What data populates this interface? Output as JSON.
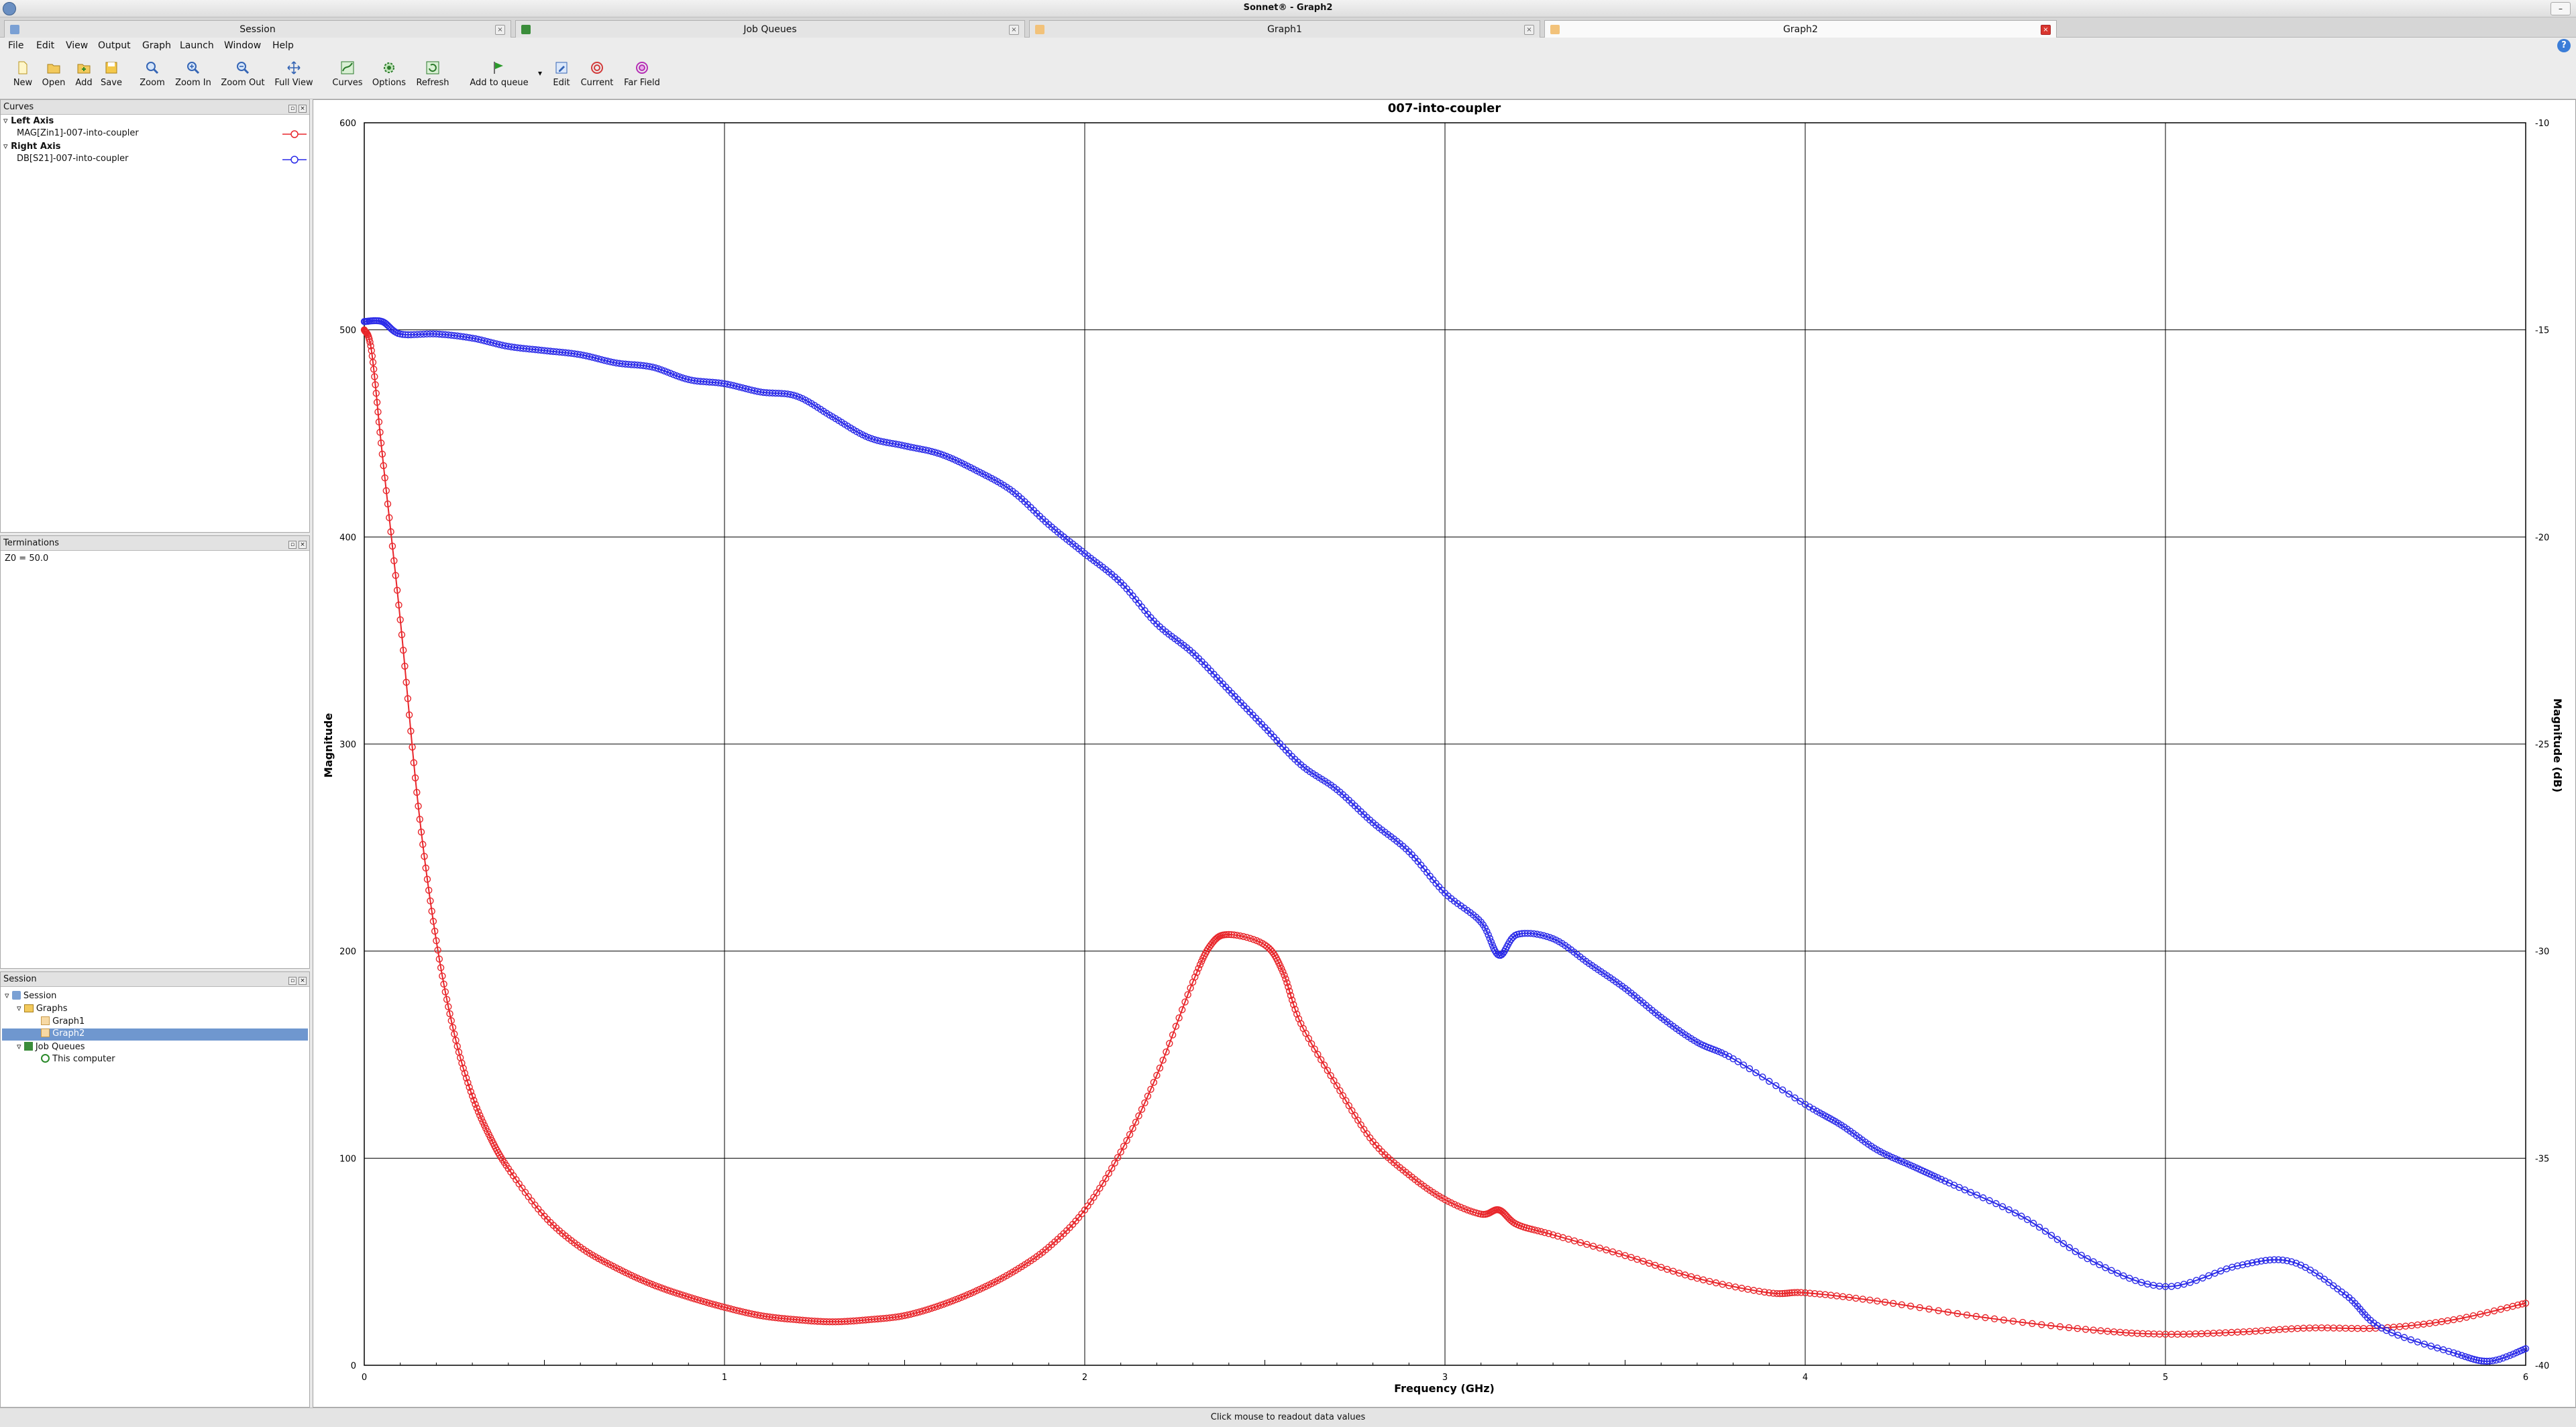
{
  "window": {
    "title": "Sonnet® - Graph2",
    "app_icon": "sonnet-app-icon"
  },
  "tabs": [
    {
      "label": "Session",
      "active": false
    },
    {
      "label": "Job Queues",
      "active": false
    },
    {
      "label": "Graph1",
      "active": false
    },
    {
      "label": "Graph2",
      "active": true
    }
  ],
  "menu": [
    "File",
    "Edit",
    "View",
    "Output",
    "Graph",
    "Launch",
    "Window",
    "Help"
  ],
  "toolbar": [
    {
      "label": "New",
      "icon": "new-file-icon"
    },
    {
      "label": "Open",
      "icon": "open-folder-icon"
    },
    {
      "label": "Add",
      "icon": "add-folder-icon"
    },
    {
      "label": "Save",
      "icon": "save-icon"
    },
    {
      "label": "Zoom",
      "icon": "zoom-icon"
    },
    {
      "label": "Zoom In",
      "icon": "zoom-in-icon"
    },
    {
      "label": "Zoom Out",
      "icon": "zoom-out-icon"
    },
    {
      "label": "Full View",
      "icon": "full-view-icon"
    },
    {
      "label": "Curves",
      "icon": "curves-icon"
    },
    {
      "label": "Options",
      "icon": "options-gear-icon"
    },
    {
      "label": "Refresh",
      "icon": "refresh-icon"
    },
    {
      "label": "Add to queue",
      "icon": "add-to-queue-icon"
    },
    {
      "label": "Edit",
      "icon": "edit-icon"
    },
    {
      "label": "Current",
      "icon": "current-icon"
    },
    {
      "label": "Far Field",
      "icon": "far-field-icon"
    }
  ],
  "curves_panel": {
    "title": "Curves",
    "left_axis_label": "Left Axis",
    "left_curve": "MAG[Zin1]-007-into-coupler",
    "right_axis_label": "Right Axis",
    "right_curve": "DB[S21]-007-into-coupler",
    "left_color": "#e8262b",
    "right_color": "#2a2ae8"
  },
  "terminations_panel": {
    "title": "Terminations",
    "value": "Z0 = 50.0"
  },
  "session_panel": {
    "title": "Session",
    "root": "Session",
    "graphs": "Graphs",
    "graph1": "Graph1",
    "graph2": "Graph2",
    "job_queues": "Job Queues",
    "this_computer": "This computer"
  },
  "status": "Click mouse to readout data values",
  "chart_data": {
    "type": "line",
    "title": "007-into-coupler",
    "xlabel": "Frequency (GHz)",
    "ylabel": "Magnitude",
    "y2label": "Magnitude (dB)",
    "xlim": [
      0,
      6
    ],
    "ylim": [
      0,
      600
    ],
    "y2lim": [
      -40,
      -10
    ],
    "xticks": [
      "0",
      "1",
      "2",
      "3",
      "4",
      "5",
      "6"
    ],
    "yticks": [
      "0",
      "100",
      "200",
      "300",
      "400",
      "500",
      "600"
    ],
    "y2ticks": [
      "-40",
      "-35",
      "-30",
      "-25",
      "-20",
      "-15",
      "-10"
    ],
    "grid": true,
    "series": [
      {
        "name": "MAG[Zin1]-007-into-coupler",
        "axis": "left",
        "color": "#e8262b",
        "x": [
          0,
          0.02,
          0.05,
          0.1,
          0.15,
          0.2,
          0.25,
          0.3,
          0.35,
          0.4,
          0.5,
          0.6,
          0.7,
          0.8,
          0.9,
          1.0,
          1.1,
          1.2,
          1.3,
          1.4,
          1.5,
          1.6,
          1.7,
          1.8,
          1.9,
          2.0,
          2.1,
          2.2,
          2.3,
          2.35,
          2.4,
          2.5,
          2.55,
          2.6,
          2.7,
          2.8,
          2.9,
          3.0,
          3.1,
          3.15,
          3.2,
          3.3,
          3.5,
          3.7,
          3.9,
          4.0,
          4.2,
          4.5,
          4.8,
          5.0,
          5.2,
          5.4,
          5.6,
          5.8,
          6.0
        ],
        "y": [
          500,
          490,
          440,
          360,
          270,
          205,
          160,
          130,
          110,
          95,
          72,
          57,
          47,
          39,
          33,
          28,
          24,
          22,
          21,
          22,
          24,
          29,
          36,
          45,
          57,
          75,
          103,
          140,
          185,
          203,
          208,
          203,
          190,
          165,
          135,
          108,
          92,
          80,
          73,
          75,
          68,
          63,
          53,
          42,
          35,
          35,
          31,
          23,
          17,
          15,
          16,
          18,
          18,
          22,
          30
        ]
      },
      {
        "name": "DB[S21]-007-into-coupler",
        "axis": "right",
        "color": "#2a2ae8",
        "x": [
          0,
          0.05,
          0.1,
          0.2,
          0.3,
          0.4,
          0.5,
          0.6,
          0.7,
          0.8,
          0.9,
          1.0,
          1.1,
          1.2,
          1.3,
          1.4,
          1.5,
          1.6,
          1.7,
          1.8,
          1.9,
          2.0,
          2.1,
          2.2,
          2.3,
          2.4,
          2.5,
          2.6,
          2.7,
          2.8,
          2.9,
          3.0,
          3.1,
          3.15,
          3.2,
          3.3,
          3.4,
          3.5,
          3.6,
          3.7,
          3.8,
          4.0,
          4.1,
          4.2,
          4.3,
          4.4,
          4.6,
          4.8,
          5.0,
          5.2,
          5.35,
          5.5,
          5.6,
          5.8,
          5.9,
          6.0
        ],
        "y": [
          -14.8,
          -14.8,
          -15.1,
          -15.1,
          -15.2,
          -15.4,
          -15.5,
          -15.6,
          -15.8,
          -15.9,
          -16.2,
          -16.3,
          -16.5,
          -16.6,
          -17.1,
          -17.6,
          -17.8,
          -18.0,
          -18.4,
          -18.9,
          -19.7,
          -20.4,
          -21.1,
          -22.1,
          -22.8,
          -23.7,
          -24.6,
          -25.5,
          -26.1,
          -26.9,
          -27.6,
          -28.6,
          -29.3,
          -30.1,
          -29.6,
          -29.7,
          -30.3,
          -30.9,
          -31.6,
          -32.2,
          -32.6,
          -33.7,
          -34.2,
          -34.8,
          -35.2,
          -35.6,
          -36.4,
          -37.5,
          -38.1,
          -37.6,
          -37.5,
          -38.3,
          -39.1,
          -39.7,
          -39.9,
          -39.6
        ]
      }
    ]
  }
}
